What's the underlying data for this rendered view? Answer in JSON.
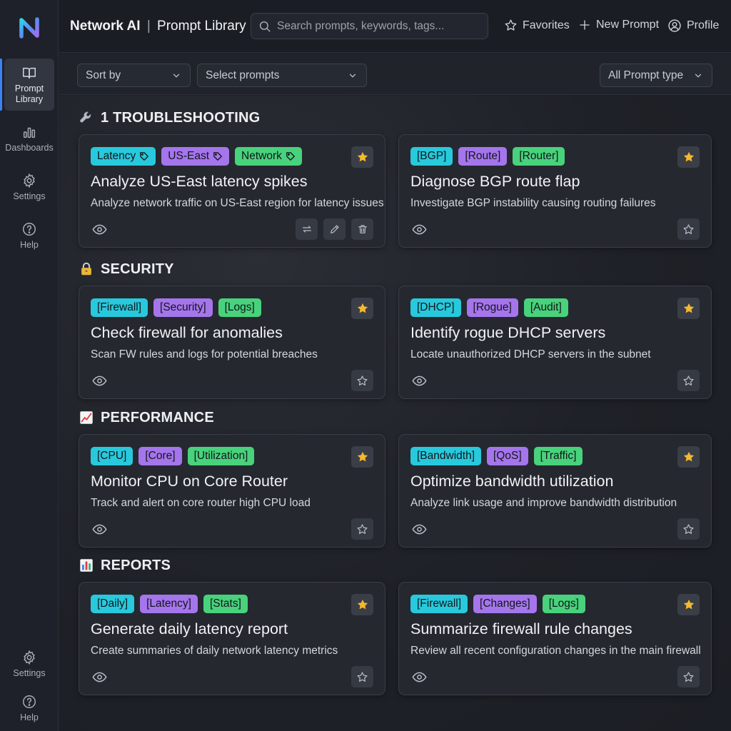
{
  "app": {
    "brand": "Network AI",
    "separator": "|",
    "page": "Prompt Library"
  },
  "search": {
    "placeholder": "Search prompts, keywords, tags..."
  },
  "header_actions": {
    "favorites": "Favorites",
    "new_prompt": "New Prompt",
    "profile": "Profile"
  },
  "sidebar": {
    "items": [
      {
        "label": "Prompt Library",
        "icon": "book-icon",
        "active": true
      },
      {
        "label": "Dashboards",
        "icon": "bar-chart-icon"
      },
      {
        "label": "Settings",
        "icon": "gear-icon"
      },
      {
        "label": "Help",
        "icon": "help-icon"
      }
    ],
    "bottom": [
      {
        "label": "Settings",
        "icon": "gear-icon"
      },
      {
        "label": "Help",
        "icon": "help-icon"
      }
    ]
  },
  "toolbar": {
    "sort": "Sort by",
    "select": "Select prompts",
    "type": "All Prompt type"
  },
  "colors": {
    "cyan": "#28c9dc",
    "purple": "#a575ec",
    "green": "#48d27c",
    "star": "#f5b82e",
    "accent": "#3b82f6"
  },
  "sections": [
    {
      "title": "1 TROUBLESHOOTING",
      "icon": "wrench-icon",
      "cards": [
        {
          "tags": [
            "Latency",
            "US-East",
            "Network"
          ],
          "title": "Analyze US-East latency spikes",
          "desc": "Analyze network traffic on US-East region for latency issues",
          "starred": true
        },
        {
          "tags": [
            "[BGP]",
            "[Route]",
            "[Router]"
          ],
          "title": "Diagnose BGP route flap",
          "desc": "Investigate BGP instability causing routing failures",
          "starred": true
        }
      ]
    },
    {
      "title": "SECURITY",
      "icon": "lock-icon",
      "cards": [
        {
          "tags": [
            "[Firewall]",
            "[Security]",
            "[Logs]"
          ],
          "title": "Check firewall for anomalies",
          "desc": "Scan FW rules and logs for potential breaches",
          "starred": true
        },
        {
          "tags": [
            "[DHCP]",
            "[Rogue]",
            "[Audit]"
          ],
          "title": "Identify rogue DHCP servers",
          "desc": "Locate unauthorized DHCP servers in the subnet",
          "starred": true
        }
      ]
    },
    {
      "title": "PERFORMANCE",
      "icon": "line-chart-icon",
      "cards": [
        {
          "tags": [
            "[CPU]",
            "[Core]",
            "[Utilization]"
          ],
          "title": "Monitor CPU on Core Router",
          "desc": "Track and alert on core router high CPU load",
          "starred": true
        },
        {
          "tags": [
            "[Bandwidth]",
            "[QoS]",
            "[Traffic]"
          ],
          "title": "Optimize bandwidth utilization",
          "desc": "Analyze link usage and improve bandwidth distribution",
          "starred": true
        }
      ]
    },
    {
      "title": "REPORTS",
      "icon": "bar-chart-icon",
      "cards": [
        {
          "tags": [
            "[Daily]",
            "[Latency]",
            "[Stats]"
          ],
          "title": "Generate daily latency report",
          "desc": "Create summaries of daily network latency metrics",
          "starred": true
        },
        {
          "tags": [
            "[Firewall]",
            "[Changes]",
            "[Logs]"
          ],
          "title": "Summarize firewall rule changes",
          "desc": "Review all recent configuration changes in the main firewall",
          "starred": true
        }
      ]
    }
  ]
}
